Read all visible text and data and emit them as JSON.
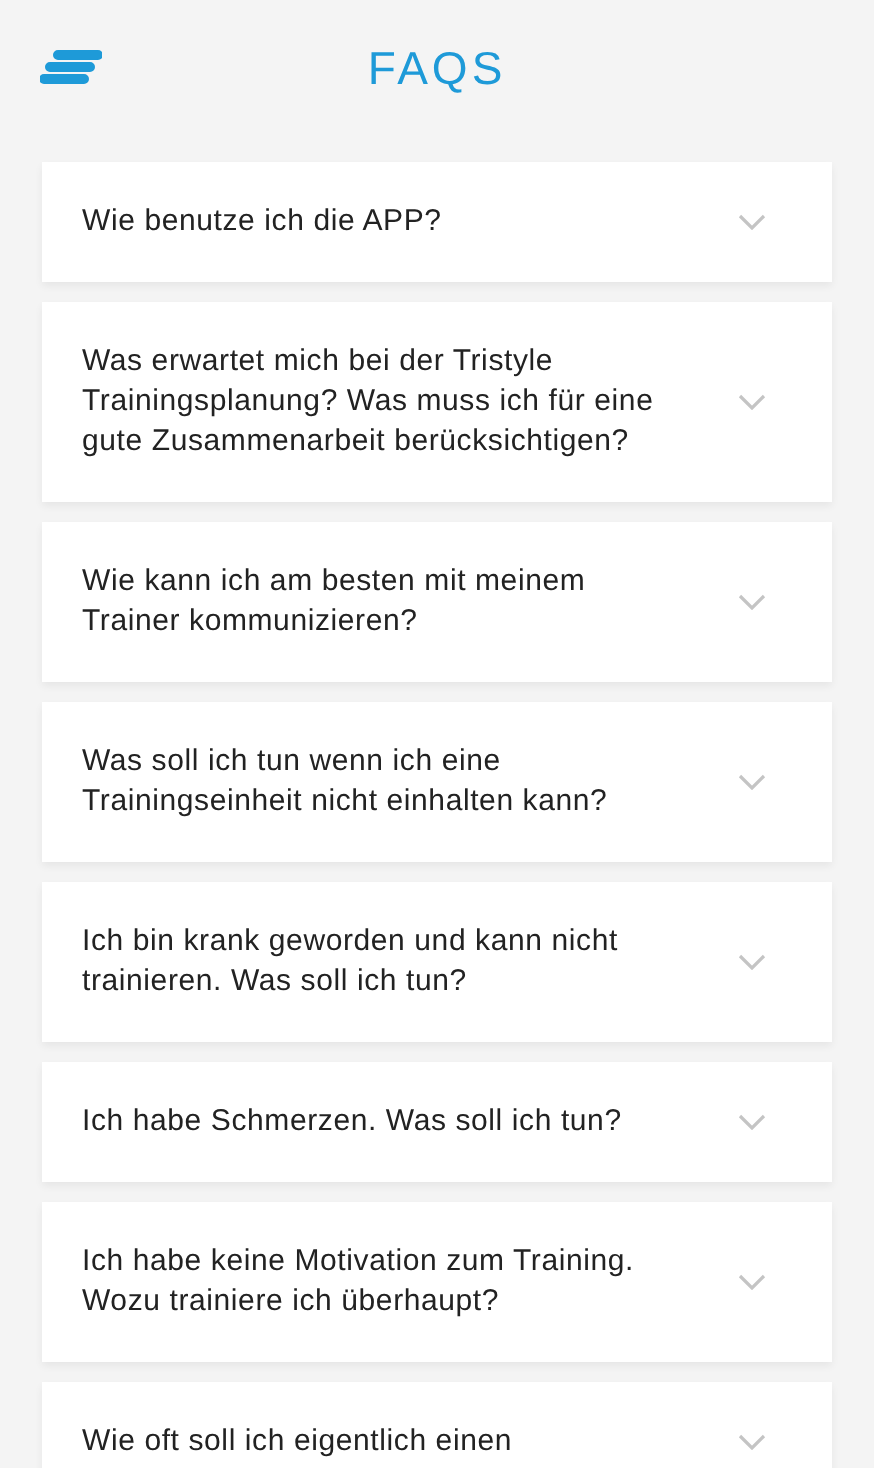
{
  "header": {
    "title": "FAQS"
  },
  "faqs": [
    {
      "question": "Wie benutze ich die APP?",
      "expanded": false
    },
    {
      "question": "Was erwartet mich bei der Tristyle Trainingsplanung? Was muss ich für eine gute Zusammenarbeit berücksichtigen?",
      "expanded": false
    },
    {
      "question": "Wie kann ich am besten mit meinem Trainer kommunizieren?",
      "expanded": false
    },
    {
      "question": "Was soll ich tun wenn ich eine Trainingseinheit nicht einhalten kann?",
      "expanded": false
    },
    {
      "question": "Ich bin krank geworden und kann nicht trainieren. Was soll ich tun?",
      "expanded": false
    },
    {
      "question": "Ich habe Schmerzen. Was soll ich tun?",
      "expanded": false
    },
    {
      "question": "Ich habe keine Motivation zum Training. Wozu trainiere ich überhaupt?",
      "expanded": false
    },
    {
      "question": "Wie oft soll ich eigentlich einen",
      "expanded": false
    }
  ]
}
